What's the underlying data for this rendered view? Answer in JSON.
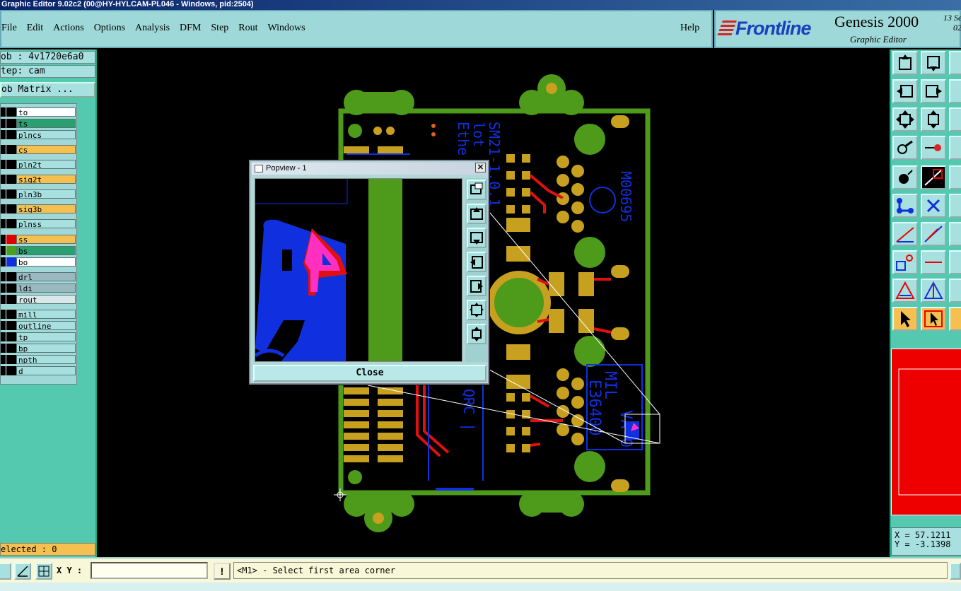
{
  "window": {
    "title": "Graphic Editor 9.02c2 (00@HY-HYLCAM-PL046 - Windows, pid:2504)"
  },
  "menu": {
    "items": [
      "File",
      "Edit",
      "Actions",
      "Options",
      "Analysis",
      "DFM",
      "Step",
      "Rout",
      "Windows"
    ],
    "help": "Help"
  },
  "brand": {
    "logo": "Frontline",
    "product": "Genesis 2000",
    "date_line1": "13 Se",
    "date_line2": "02:",
    "subtitle": "Graphic Editor"
  },
  "job": {
    "job_line": "ob : 4v1720e6a0",
    "step_line": "tep: cam",
    "matrix_button": "ob Matrix ..."
  },
  "layers": [
    {
      "name": "to",
      "color": "#ffffff",
      "swatch": "#000000"
    },
    {
      "name": "ts",
      "color": "#2aa070",
      "swatch": "#000000"
    },
    {
      "name": "plncs",
      "color": "#a8e0e0",
      "swatch": "#000000"
    },
    {
      "name": "cs",
      "color": "#f5c050",
      "swatch": "#000000"
    },
    {
      "name": "pln2t",
      "color": "#a8e0e0",
      "swatch": "#000000"
    },
    {
      "name": "sig2t",
      "color": "#f5c050",
      "swatch": "#000000"
    },
    {
      "name": "pln3b",
      "color": "#a8e0e0",
      "swatch": "#000000"
    },
    {
      "name": "sig3b",
      "color": "#f5c050",
      "swatch": "#000000"
    },
    {
      "name": "plnss",
      "color": "#a8e0e0",
      "swatch": "#000000"
    },
    {
      "name": "ss",
      "color": "#f5c050",
      "swatch": "#e00000"
    },
    {
      "name": "bs",
      "color": "#2aa070",
      "swatch": "#4aa020"
    },
    {
      "name": "bo",
      "color": "#ffffff",
      "swatch": "#1030e0"
    },
    {
      "name": "drl",
      "color": "#9ab8c0",
      "swatch": "#000000"
    },
    {
      "name": "ldi",
      "color": "#9ab8c0",
      "swatch": "#000000"
    },
    {
      "name": "rout",
      "color": "#d8e8e8",
      "swatch": "#000000"
    },
    {
      "name": "mill",
      "color": "#a8e0e0",
      "swatch": "#000000"
    },
    {
      "name": "outline",
      "color": "#a8e0e0",
      "swatch": "#000000"
    },
    {
      "name": "tp",
      "color": "#a8e0e0",
      "swatch": "#000000"
    },
    {
      "name": "bp",
      "color": "#a8e0e0",
      "swatch": "#000000"
    },
    {
      "name": "npth",
      "color": "#a8e0e0",
      "swatch": "#000000"
    },
    {
      "name": "d",
      "color": "#a8e0e0",
      "swatch": "#000000"
    }
  ],
  "selected": "elected : 0",
  "coords": {
    "x": "X = 57.1211",
    "y": "Y = -3.1398"
  },
  "bottom": {
    "xy_label": "X Y :",
    "xy_value": "",
    "warn": "!",
    "status": "<M1> - Select first area corner"
  },
  "popview": {
    "title": "Popview - 1",
    "close": "Close"
  },
  "board_text": {
    "sm_text": "SM21-1.0.1",
    "col2": "lot",
    "col3": "Ethe",
    "code": "M00695",
    "mil1": "MIL",
    "mil2": "E36400",
    "mil3": "VA-0",
    "qrc": "QRC |"
  },
  "colors": {
    "board": "#4e9a1a",
    "pad": "#c8a020",
    "trace": "#e01010",
    "silk": "#1030e0",
    "mask": "#ff30c0"
  }
}
